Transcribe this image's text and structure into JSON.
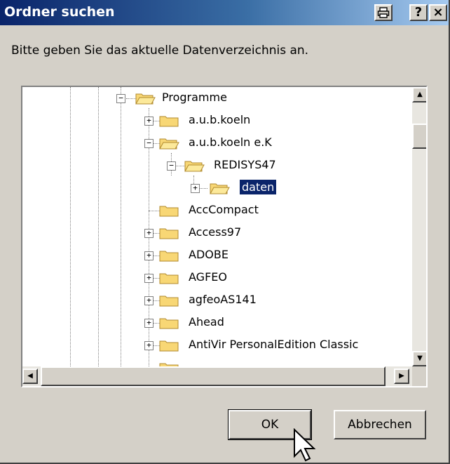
{
  "window": {
    "title": "Ordner suchen",
    "title_buttons": [
      "printer-icon",
      "?",
      "×"
    ]
  },
  "instruction": "Bitte geben Sie das aktuelle Datenverzeichnis an.",
  "tree": {
    "items": [
      {
        "label": "Programme",
        "expander": "minus"
      },
      {
        "label": "a.u.b.koeln",
        "expander": "plus"
      },
      {
        "label": "a.u.b.koeln e.K",
        "expander": "minus"
      },
      {
        "label": "REDISYS47",
        "expander": "minus"
      },
      {
        "label": "daten",
        "expander": "plus",
        "selected": true
      },
      {
        "label": "AccCompact",
        "expander": "none"
      },
      {
        "label": "Access97",
        "expander": "plus"
      },
      {
        "label": "ADOBE",
        "expander": "plus"
      },
      {
        "label": "AGFEO",
        "expander": "plus"
      },
      {
        "label": "agfeoAS141",
        "expander": "plus"
      },
      {
        "label": "Ahead",
        "expander": "plus"
      },
      {
        "label": "AntiVir PersonalEdition Classic",
        "expander": "plus"
      }
    ]
  },
  "buttons": {
    "ok": "OK",
    "cancel": "Abbrechen"
  },
  "colors": {
    "titlebar_start": "#0a246a",
    "titlebar_end": "#a6caf0",
    "selection": "#0a246a",
    "folder": "#f8d775"
  }
}
